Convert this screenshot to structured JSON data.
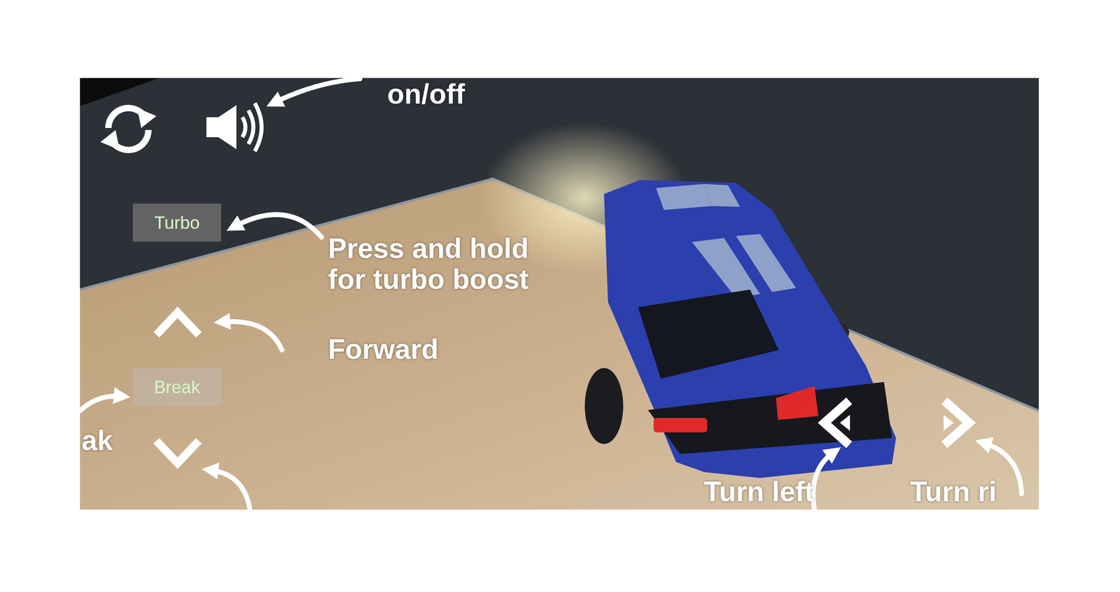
{
  "sound": {
    "on": true
  },
  "buttons": [
    {
      "label": "Turbo",
      "kind": "turbo"
    },
    {
      "label": "Break",
      "kind": "brake"
    }
  ],
  "annotations": [
    {
      "lines": [
        "on/off"
      ]
    },
    {
      "lines": [
        "Press and hold",
        "for turbo boost"
      ]
    },
    {
      "lines": [
        "Forward"
      ]
    },
    {
      "lines": [
        "ak"
      ]
    },
    {
      "lines": [
        "Turn left"
      ]
    },
    {
      "lines": [
        "Turn ri"
      ]
    }
  ]
}
